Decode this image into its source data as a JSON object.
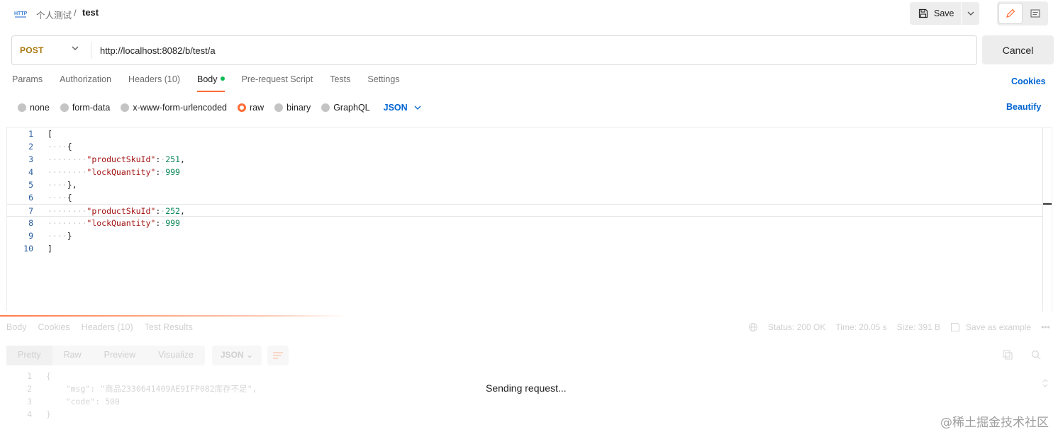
{
  "header": {
    "breadcrumb_parent": "个人测试",
    "breadcrumb_sep": "/",
    "breadcrumb_current": "test",
    "save_label": "Save"
  },
  "request": {
    "method": "POST",
    "url": "http://localhost:8082/b/test/a",
    "cancel_label": "Cancel"
  },
  "tabs": [
    {
      "label": "Params"
    },
    {
      "label": "Authorization"
    },
    {
      "label": "Headers (10)"
    },
    {
      "label": "Body",
      "active": true
    },
    {
      "label": "Pre-request Script"
    },
    {
      "label": "Tests"
    },
    {
      "label": "Settings"
    }
  ],
  "cookies_label": "Cookies",
  "body_types": [
    {
      "label": "none"
    },
    {
      "label": "form-data"
    },
    {
      "label": "x-www-form-urlencoded"
    },
    {
      "label": "raw",
      "selected": true
    },
    {
      "label": "binary"
    },
    {
      "label": "GraphQL"
    }
  ],
  "body_language": "JSON",
  "beautify_label": "Beautify",
  "editor": {
    "lines": [
      {
        "n": "1",
        "indent": "",
        "parts": [
          [
            "p",
            "["
          ]
        ]
      },
      {
        "n": "2",
        "indent": "····",
        "parts": [
          [
            "p",
            "{"
          ]
        ]
      },
      {
        "n": "3",
        "indent": "········",
        "parts": [
          [
            "k",
            "\"productSkuId\""
          ],
          [
            "p",
            ":"
          ],
          [
            "w",
            "·"
          ],
          [
            "n",
            "251"
          ],
          [
            "p",
            ","
          ]
        ]
      },
      {
        "n": "4",
        "indent": "········",
        "parts": [
          [
            "k",
            "\"lockQuantity\""
          ],
          [
            "p",
            ":"
          ],
          [
            "w",
            "·"
          ],
          [
            "n",
            "999"
          ]
        ]
      },
      {
        "n": "5",
        "indent": "····",
        "parts": [
          [
            "p",
            "},"
          ]
        ]
      },
      {
        "n": "6",
        "indent": "····",
        "parts": [
          [
            "p",
            "{"
          ]
        ]
      },
      {
        "n": "7",
        "indent": "········",
        "parts": [
          [
            "k",
            "\"productSkuId\""
          ],
          [
            "p",
            ":"
          ],
          [
            "w",
            "·"
          ],
          [
            "n",
            "252"
          ],
          [
            "p",
            ","
          ]
        ],
        "current": true
      },
      {
        "n": "8",
        "indent": "········",
        "parts": [
          [
            "k",
            "\"lockQuantity\""
          ],
          [
            "p",
            ":"
          ],
          [
            "w",
            "·"
          ],
          [
            "n",
            "999"
          ]
        ]
      },
      {
        "n": "9",
        "indent": "····",
        "parts": [
          [
            "p",
            "}"
          ]
        ]
      },
      {
        "n": "10",
        "indent": "",
        "parts": [
          [
            "p",
            "]"
          ]
        ]
      }
    ]
  },
  "response": {
    "tabs": [
      "Body",
      "Cookies",
      "Headers (10)",
      "Test Results"
    ],
    "status": "Status: 200 OK",
    "time": "Time: 20.05 s",
    "size": "Size: 391 B",
    "save_example": "Save as example",
    "more": "•••",
    "views": [
      "Pretty",
      "Raw",
      "Preview",
      "Visualize"
    ],
    "format": "JSON",
    "lines": [
      {
        "n": "1",
        "text": "{"
      },
      {
        "n": "2",
        "text": "    \"msg\": \"商品2330641409AE9IFP082库存不足\","
      },
      {
        "n": "3",
        "text": "    \"code\": 500"
      },
      {
        "n": "4",
        "text": "}"
      }
    ],
    "sending_text": "Sending request..."
  },
  "watermark": "@稀土掘金技术社区",
  "colors": {
    "accent": "#ff6c37",
    "link": "#0265d2",
    "method": "#a8750a",
    "json_key": "#a31515",
    "json_number": "#098658"
  }
}
